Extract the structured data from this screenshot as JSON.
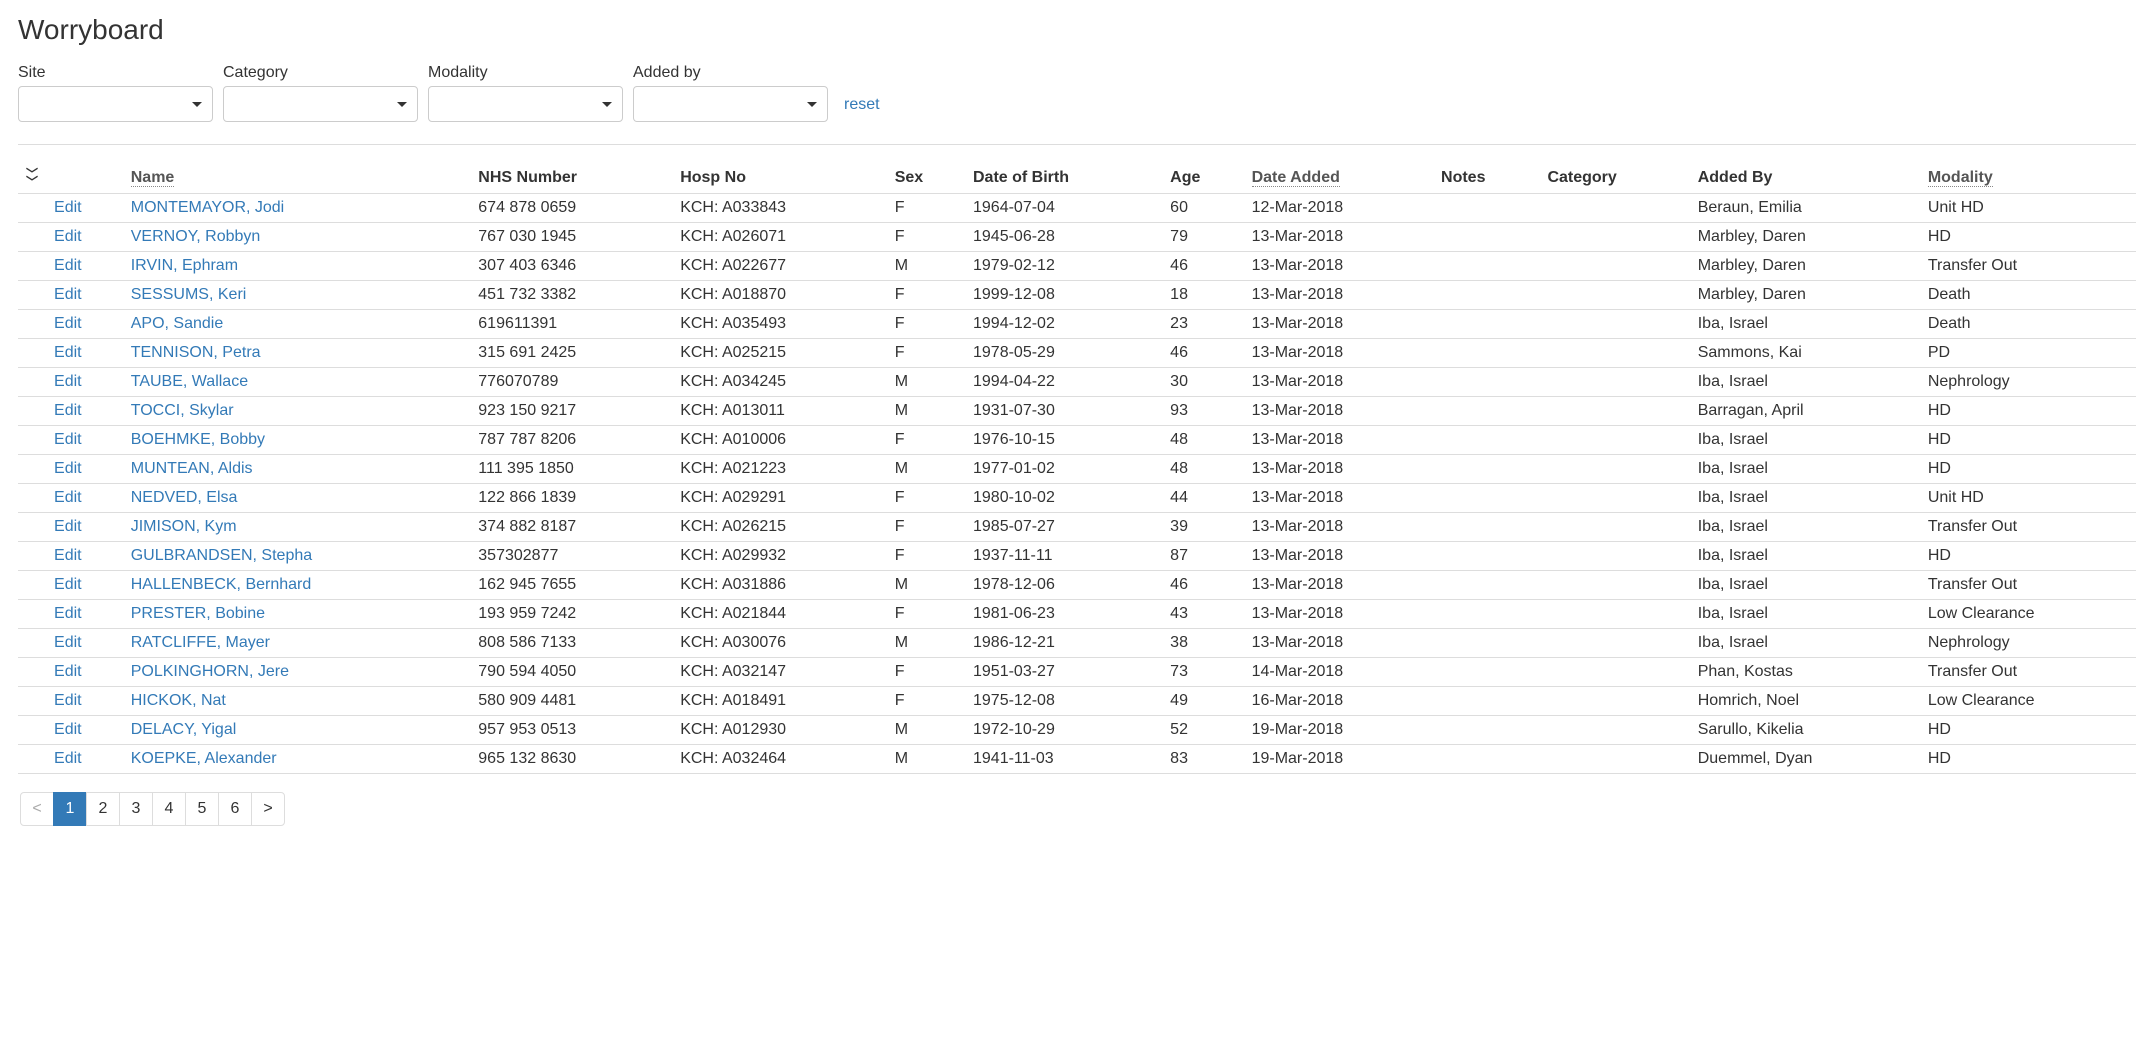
{
  "header": {
    "title": "Worryboard"
  },
  "filters": {
    "site": {
      "label": "Site",
      "value": ""
    },
    "category": {
      "label": "Category",
      "value": ""
    },
    "modality": {
      "label": "Modality",
      "value": ""
    },
    "added_by": {
      "label": "Added by",
      "value": ""
    },
    "reset_label": "reset"
  },
  "table": {
    "columns": {
      "name": "Name",
      "nhs_number": "NHS Number",
      "hosp_no": "Hosp No",
      "sex": "Sex",
      "dob": "Date of Birth",
      "age": "Age",
      "date_added": "Date Added",
      "notes": "Notes",
      "category": "Category",
      "added_by": "Added By",
      "modality": "Modality"
    },
    "edit_label": "Edit",
    "rows": [
      {
        "name": "MONTEMAYOR, Jodi",
        "nhs": "674 878 0659",
        "hosp": "KCH: A033843",
        "sex": "F",
        "dob": "1964-07-04",
        "age": "60",
        "date_added": "12-Mar-2018",
        "notes": "",
        "category": "",
        "added_by": "Beraun, Emilia",
        "modality": "Unit HD"
      },
      {
        "name": "VERNOY, Robbyn",
        "nhs": "767 030 1945",
        "hosp": "KCH: A026071",
        "sex": "F",
        "dob": "1945-06-28",
        "age": "79",
        "date_added": "13-Mar-2018",
        "notes": "",
        "category": "",
        "added_by": "Marbley, Daren",
        "modality": "HD"
      },
      {
        "name": "IRVIN, Ephram",
        "nhs": "307 403 6346",
        "hosp": "KCH: A022677",
        "sex": "M",
        "dob": "1979-02-12",
        "age": "46",
        "date_added": "13-Mar-2018",
        "notes": "",
        "category": "",
        "added_by": "Marbley, Daren",
        "modality": "Transfer Out"
      },
      {
        "name": "SESSUMS, Keri",
        "nhs": "451 732 3382",
        "hosp": "KCH: A018870",
        "sex": "F",
        "dob": "1999-12-08",
        "age": "18",
        "date_added": "13-Mar-2018",
        "notes": "",
        "category": "",
        "added_by": "Marbley, Daren",
        "modality": "Death"
      },
      {
        "name": "APO, Sandie",
        "nhs": "619611391",
        "hosp": "KCH: A035493",
        "sex": "F",
        "dob": "1994-12-02",
        "age": "23",
        "date_added": "13-Mar-2018",
        "notes": "",
        "category": "",
        "added_by": "Iba, Israel",
        "modality": "Death"
      },
      {
        "name": "TENNISON, Petra",
        "nhs": "315 691 2425",
        "hosp": "KCH: A025215",
        "sex": "F",
        "dob": "1978-05-29",
        "age": "46",
        "date_added": "13-Mar-2018",
        "notes": "",
        "category": "",
        "added_by": "Sammons, Kai",
        "modality": "PD"
      },
      {
        "name": "TAUBE, Wallace",
        "nhs": "776070789",
        "hosp": "KCH: A034245",
        "sex": "M",
        "dob": "1994-04-22",
        "age": "30",
        "date_added": "13-Mar-2018",
        "notes": "",
        "category": "",
        "added_by": "Iba, Israel",
        "modality": "Nephrology"
      },
      {
        "name": "TOCCI, Skylar",
        "nhs": "923 150 9217",
        "hosp": "KCH: A013011",
        "sex": "M",
        "dob": "1931-07-30",
        "age": "93",
        "date_added": "13-Mar-2018",
        "notes": "",
        "category": "",
        "added_by": "Barragan, April",
        "modality": "HD"
      },
      {
        "name": "BOEHMKE, Bobby",
        "nhs": "787 787 8206",
        "hosp": "KCH: A010006",
        "sex": "F",
        "dob": "1976-10-15",
        "age": "48",
        "date_added": "13-Mar-2018",
        "notes": "",
        "category": "",
        "added_by": "Iba, Israel",
        "modality": "HD"
      },
      {
        "name": "MUNTEAN, Aldis",
        "nhs": "111 395 1850",
        "hosp": "KCH: A021223",
        "sex": "M",
        "dob": "1977-01-02",
        "age": "48",
        "date_added": "13-Mar-2018",
        "notes": "",
        "category": "",
        "added_by": "Iba, Israel",
        "modality": "HD"
      },
      {
        "name": "NEDVED, Elsa",
        "nhs": "122 866 1839",
        "hosp": "KCH: A029291",
        "sex": "F",
        "dob": "1980-10-02",
        "age": "44",
        "date_added": "13-Mar-2018",
        "notes": "",
        "category": "",
        "added_by": "Iba, Israel",
        "modality": "Unit HD"
      },
      {
        "name": "JIMISON, Kym",
        "nhs": "374 882 8187",
        "hosp": "KCH: A026215",
        "sex": "F",
        "dob": "1985-07-27",
        "age": "39",
        "date_added": "13-Mar-2018",
        "notes": "",
        "category": "",
        "added_by": "Iba, Israel",
        "modality": "Transfer Out"
      },
      {
        "name": "GULBRANDSEN, Stepha",
        "nhs": "357302877",
        "hosp": "KCH: A029932",
        "sex": "F",
        "dob": "1937-11-11",
        "age": "87",
        "date_added": "13-Mar-2018",
        "notes": "",
        "category": "",
        "added_by": "Iba, Israel",
        "modality": "HD"
      },
      {
        "name": "HALLENBECK, Bernhard",
        "nhs": "162 945 7655",
        "hosp": "KCH: A031886",
        "sex": "M",
        "dob": "1978-12-06",
        "age": "46",
        "date_added": "13-Mar-2018",
        "notes": "",
        "category": "",
        "added_by": "Iba, Israel",
        "modality": "Transfer Out"
      },
      {
        "name": "PRESTER, Bobine",
        "nhs": "193 959 7242",
        "hosp": "KCH: A021844",
        "sex": "F",
        "dob": "1981-06-23",
        "age": "43",
        "date_added": "13-Mar-2018",
        "notes": "",
        "category": "",
        "added_by": "Iba, Israel",
        "modality": "Low Clearance"
      },
      {
        "name": "RATCLIFFE, Mayer",
        "nhs": "808 586 7133",
        "hosp": "KCH: A030076",
        "sex": "M",
        "dob": "1986-12-21",
        "age": "38",
        "date_added": "13-Mar-2018",
        "notes": "",
        "category": "",
        "added_by": "Iba, Israel",
        "modality": "Nephrology"
      },
      {
        "name": "POLKINGHORN, Jere",
        "nhs": "790 594 4050",
        "hosp": "KCH: A032147",
        "sex": "F",
        "dob": "1951-03-27",
        "age": "73",
        "date_added": "14-Mar-2018",
        "notes": "",
        "category": "",
        "added_by": "Phan, Kostas",
        "modality": "Transfer Out"
      },
      {
        "name": "HICKOK, Nat",
        "nhs": "580 909 4481",
        "hosp": "KCH: A018491",
        "sex": "F",
        "dob": "1975-12-08",
        "age": "49",
        "date_added": "16-Mar-2018",
        "notes": "",
        "category": "",
        "added_by": "Homrich, Noel",
        "modality": "Low Clearance"
      },
      {
        "name": "DELACY, Yigal",
        "nhs": "957 953 0513",
        "hosp": "KCH: A012930",
        "sex": "M",
        "dob": "1972-10-29",
        "age": "52",
        "date_added": "19-Mar-2018",
        "notes": "",
        "category": "",
        "added_by": "Sarullo, Kikelia",
        "modality": "HD"
      },
      {
        "name": "KOEPKE, Alexander",
        "nhs": "965 132 8630",
        "hosp": "KCH: A032464",
        "sex": "M",
        "dob": "1941-11-03",
        "age": "83",
        "date_added": "19-Mar-2018",
        "notes": "",
        "category": "",
        "added_by": "Duemmel, Dyan",
        "modality": "HD"
      }
    ]
  },
  "pagination": {
    "prev_label": "<",
    "next_label": ">",
    "pages": [
      "1",
      "2",
      "3",
      "4",
      "5",
      "6"
    ],
    "active": "1"
  }
}
